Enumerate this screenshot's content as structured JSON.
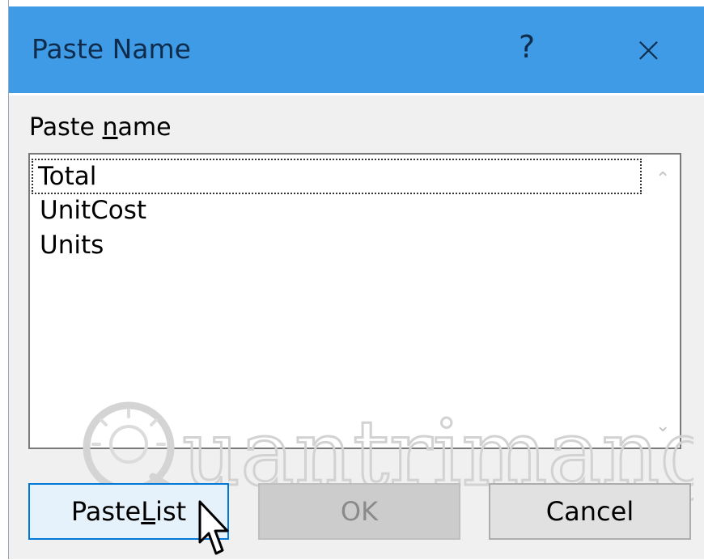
{
  "window": {
    "title": "Paste Name",
    "help_glyph": "?",
    "close_glyph": "×"
  },
  "list": {
    "label_prefix": "Paste ",
    "label_accel": "n",
    "label_suffix": "ame",
    "items": [
      "Total",
      "UnitCost",
      "Units"
    ],
    "selected_index": 0
  },
  "buttons": {
    "paste_list_prefix": "Paste ",
    "paste_list_accel": "L",
    "paste_list_suffix": "ist",
    "ok": "OK",
    "cancel": "Cancel"
  },
  "watermark": {
    "text": "uantrimang"
  },
  "colors": {
    "titlebar": "#3f9be5",
    "title_text": "#0f2c4c",
    "focus_border": "#0078d7"
  }
}
